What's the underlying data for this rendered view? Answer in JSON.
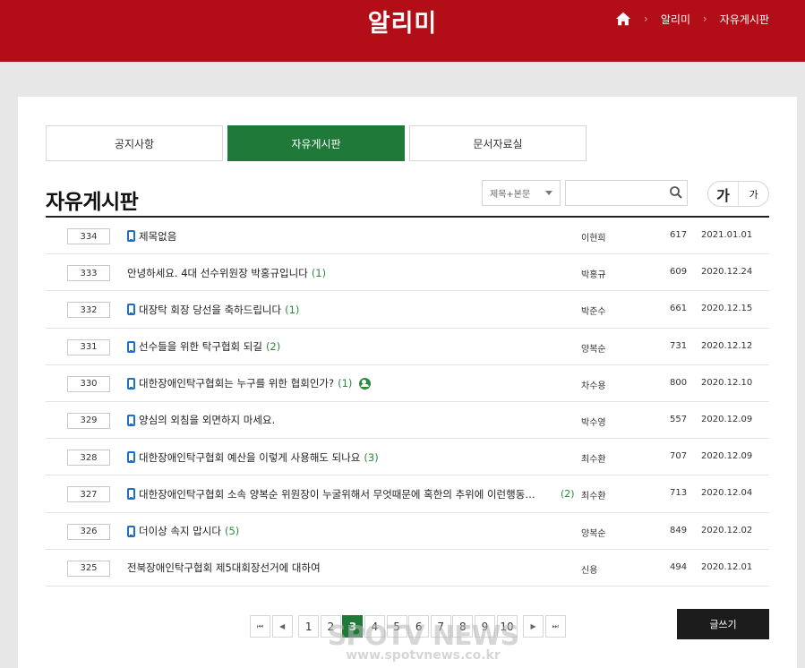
{
  "header": {
    "title": "알리미",
    "breadcrumb": [
      "알리미",
      "자유게시판"
    ],
    "accent_color": "#b30e17"
  },
  "tabs": [
    {
      "label": "공지사항",
      "active": false
    },
    {
      "label": "자유게시판",
      "active": true
    },
    {
      "label": "문서자료실",
      "active": false
    }
  ],
  "board": {
    "title": "자유게시판",
    "search_select": "제목+본문",
    "search_placeholder": "",
    "font_big": "가",
    "font_small": "가",
    "write_label": "글쓰기"
  },
  "posts": [
    {
      "num": "334",
      "mobile": true,
      "subject": "제목없음",
      "comments": "",
      "new": false,
      "author": "이현희",
      "views": "617",
      "date": "2021.01.01"
    },
    {
      "num": "333",
      "mobile": false,
      "subject": "안녕하세요. 4대 선수위원장 박홍규입니다",
      "comments": "(1)",
      "new": false,
      "author": "박홍규",
      "views": "609",
      "date": "2020.12.24"
    },
    {
      "num": "332",
      "mobile": true,
      "subject": "대장탁 회장 당선을 축하드립니다",
      "comments": "(1)",
      "new": false,
      "author": "박준수",
      "views": "661",
      "date": "2020.12.15"
    },
    {
      "num": "331",
      "mobile": true,
      "subject": "선수들을 위한 탁구협회 되길",
      "comments": "(2)",
      "new": false,
      "author": "양복순",
      "views": "731",
      "date": "2020.12.12"
    },
    {
      "num": "330",
      "mobile": true,
      "subject": "대한장애인탁구협회는 누구를 위한 협회인가?",
      "comments": "(1)",
      "new": true,
      "author": "차수용",
      "views": "800",
      "date": "2020.12.10"
    },
    {
      "num": "329",
      "mobile": true,
      "subject": "양심의 외침을 외면하지 마세요.",
      "comments": "",
      "new": false,
      "author": "박수영",
      "views": "557",
      "date": "2020.12.09"
    },
    {
      "num": "328",
      "mobile": true,
      "subject": "대한장애인탁구협회 예산을 이렇게 사용해도 되나요",
      "comments": "(3)",
      "new": false,
      "author": "최수환",
      "views": "707",
      "date": "2020.12.09"
    },
    {
      "num": "327",
      "mobile": true,
      "subject": "대한장애인탁구협회 소속 양복순 위원장이 누굴위해서 무엇때문에 혹한의 추위에 이런행동…",
      "comments": "(2)",
      "new": false,
      "long": true,
      "author": "최수환",
      "views": "713",
      "date": "2020.12.04"
    },
    {
      "num": "326",
      "mobile": true,
      "subject": "더이상 속지 맙시다",
      "comments": "(5)",
      "new": false,
      "author": "양복순",
      "views": "849",
      "date": "2020.12.02"
    },
    {
      "num": "325",
      "mobile": false,
      "subject": "전북장애인탁구협회 제5대회장선거에 대하여",
      "comments": "",
      "new": false,
      "author": "신용",
      "views": "494",
      "date": "2020.12.01"
    }
  ],
  "pagination": {
    "first": "⏮",
    "prev": "◀",
    "pages": [
      "1",
      "2",
      "3",
      "4",
      "5",
      "6",
      "7",
      "8",
      "9",
      "10"
    ],
    "current": "3",
    "next": "▶",
    "last": "⏭"
  },
  "watermark": {
    "main": "SPOTV NEWS",
    "sub": "www.spotvnews.co.kr"
  }
}
